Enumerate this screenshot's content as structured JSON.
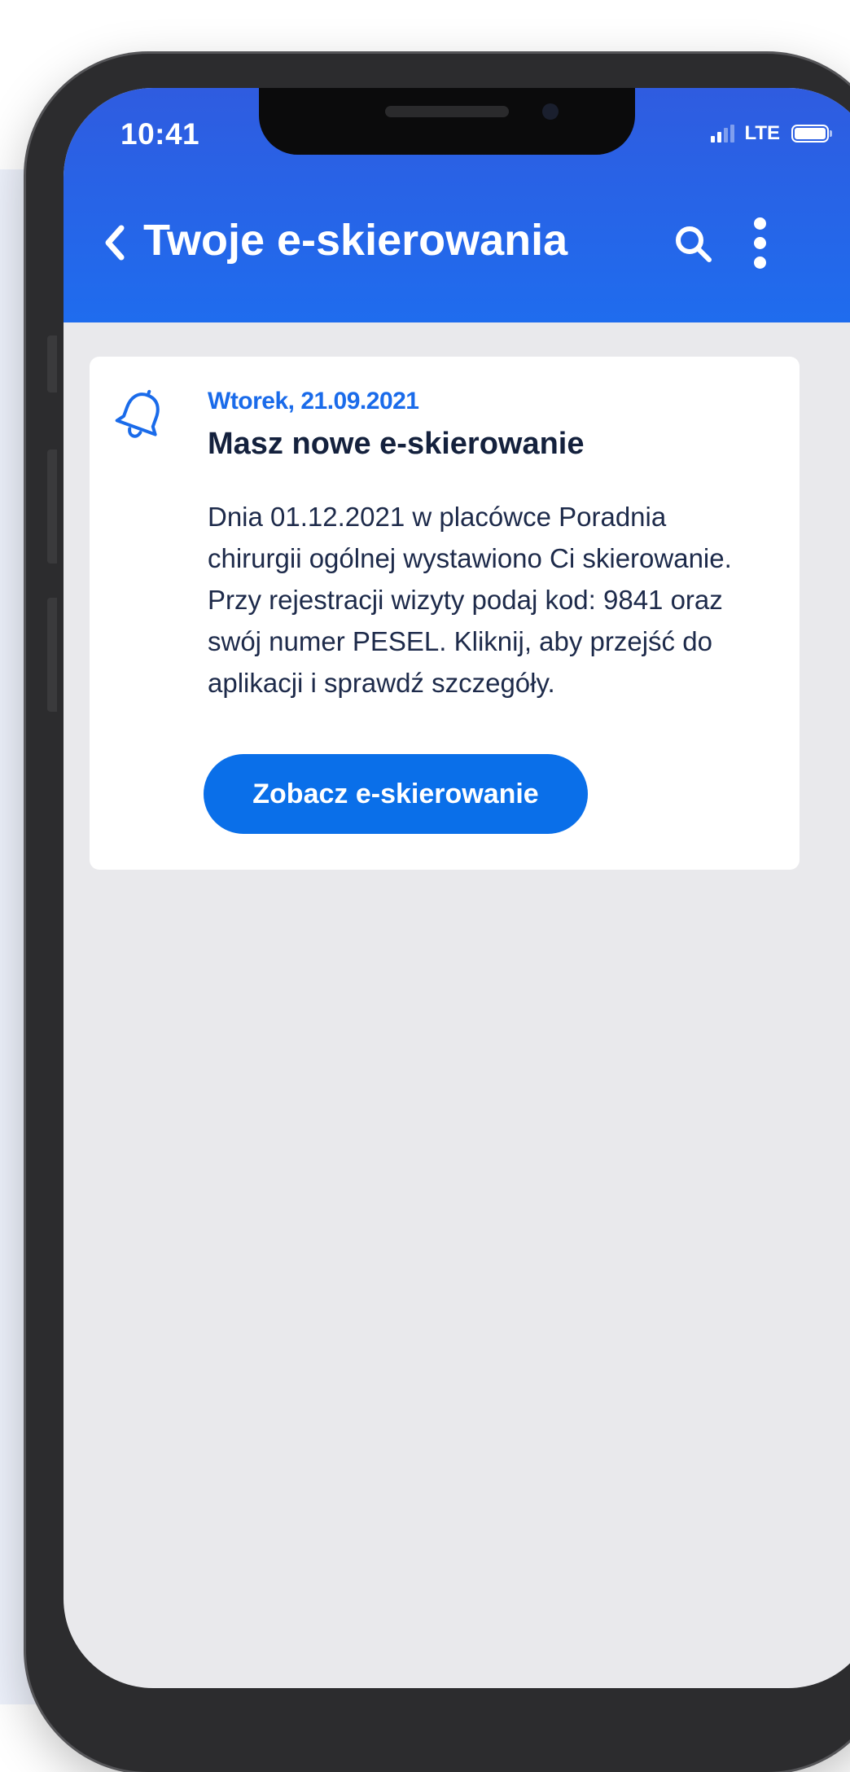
{
  "status_bar": {
    "time": "10:41",
    "network": "LTE"
  },
  "header": {
    "title": "Twoje e-skierowania",
    "back_icon": "chevron-left-icon",
    "search_icon": "search-icon",
    "more_icon": "more-vertical-icon"
  },
  "notification": {
    "icon": "bell-icon",
    "date": "Wtorek, 21.09.2021",
    "title": "Masz nowe e-skierowanie",
    "body": "Dnia  01.12.2021  w placówce  Poradnia chirurgii ogólnej  wystawiono Ci skierowanie. Przy rejestracji wizyty podaj kod:  9841  oraz swój numer PESEL. Kliknij, aby przejść do aplikacji i sprawdź szczegóły.",
    "button_label": "Zobacz e-skierowanie"
  },
  "colors": {
    "header_blue": "#2f5ce0",
    "accent_blue": "#0a6fe9",
    "date_blue": "#1a6bea",
    "screen_background": "#e9e9ec"
  }
}
